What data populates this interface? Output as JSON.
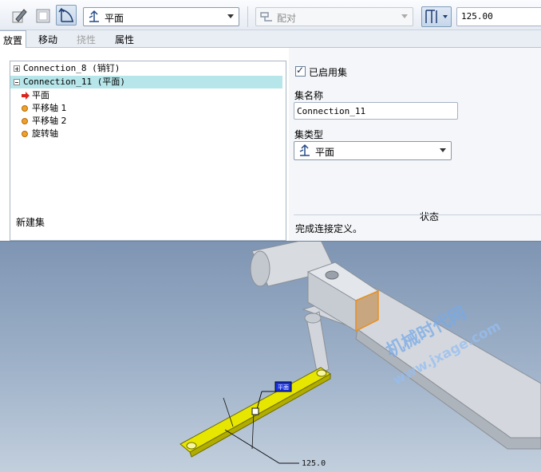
{
  "toolbar": {
    "constraint_type": "平面",
    "constraint_state": "配对",
    "offset_value": "125.00",
    "icons": [
      "edit-icon",
      "window-icon",
      "axis-pin-icon",
      "connection-plane-icon",
      "align-icon",
      "offset-icon"
    ]
  },
  "tabs": [
    {
      "label": "放置",
      "selected": true
    },
    {
      "label": "移动",
      "selected": false
    },
    {
      "label": "挠性",
      "selected": false,
      "disabled": true
    },
    {
      "label": "属性",
      "selected": false
    }
  ],
  "tree": {
    "items": [
      {
        "label": "Connection_8 (销钉)",
        "expanded": false
      },
      {
        "label": "Connection_11 (平面)",
        "expanded": true,
        "selected": true
      },
      {
        "label": "平面",
        "child": true,
        "icon": "red-arrow-icon"
      },
      {
        "label": "平移轴 1",
        "child": true,
        "icon": "orange-dot-icon"
      },
      {
        "label": "平移轴 2",
        "child": true,
        "icon": "orange-dot-icon"
      },
      {
        "label": "旋转轴",
        "child": true,
        "icon": "orange-dot-icon"
      }
    ],
    "new_set": "新建集"
  },
  "settings": {
    "enabled_label": "已启用集",
    "enabled": true,
    "set_name_label": "集名称",
    "set_name_value": "Connection_11",
    "set_type_label": "集类型",
    "set_type_value": "平面",
    "status_label": "状态",
    "status_text": "完成连接定义。"
  },
  "viewport": {
    "dimension_text": "125.0",
    "tag_text": "平面",
    "watermark_line1": "机械时代网",
    "watermark_line2": "www.jxage.com"
  },
  "colors": {
    "accent": "#b6e6ea",
    "highlight": "#e6e600",
    "part": "#d7dbe0",
    "background": "#8fa4bf"
  }
}
